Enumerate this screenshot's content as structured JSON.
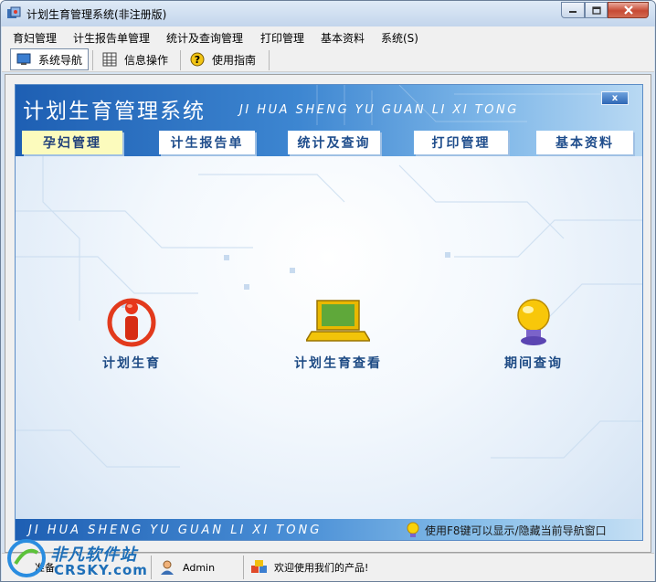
{
  "window": {
    "title": "计划生育管理系统(非注册版)",
    "min_icon": "minimize-icon",
    "max_icon": "maximize-icon",
    "close_icon": "close-icon"
  },
  "menu": {
    "items": [
      "育妇管理",
      "计生报告单管理",
      "统计及查询管理",
      "打印管理",
      "基本资料",
      "系统(S)"
    ]
  },
  "toolbar": {
    "buttons": [
      {
        "label": "系统导航",
        "icon": "monitor-icon",
        "active": true
      },
      {
        "label": "信息操作",
        "icon": "grid-icon",
        "active": false
      },
      {
        "label": "使用指南",
        "icon": "help-icon",
        "active": false
      }
    ]
  },
  "panel": {
    "title": "计划生育管理系统",
    "pinyin": "JI HUA SHENG YU GUAN LI XI TONG",
    "close_label": "x",
    "tabs": [
      "孕妇管理",
      "计生报告单",
      "统计及查询",
      "打印管理",
      "基本资料"
    ],
    "active_tab": 0,
    "features": [
      {
        "label": "计划生育",
        "icon": "person-info-icon"
      },
      {
        "label": "计划生育查看",
        "icon": "laptop-icon"
      },
      {
        "label": "期间查询",
        "icon": "lightbulb-icon"
      }
    ],
    "footer_pinyin": "JI HUA SHENG YU GUAN LI XI TONG",
    "footer_hint": "使用F8键可以显示/隐藏当前导航窗口"
  },
  "status": {
    "cell1": "准备",
    "user": "Admin",
    "welcome": "欢迎使用我们的产品!"
  },
  "watermark": {
    "text": "非凡软件站",
    "sub": "CRSKY.com"
  },
  "colors": {
    "banner": "#2a6fc4",
    "tab_active": "#fcfbbd",
    "tab_text": "#1f4d8c",
    "close_button": "#c74a34"
  }
}
